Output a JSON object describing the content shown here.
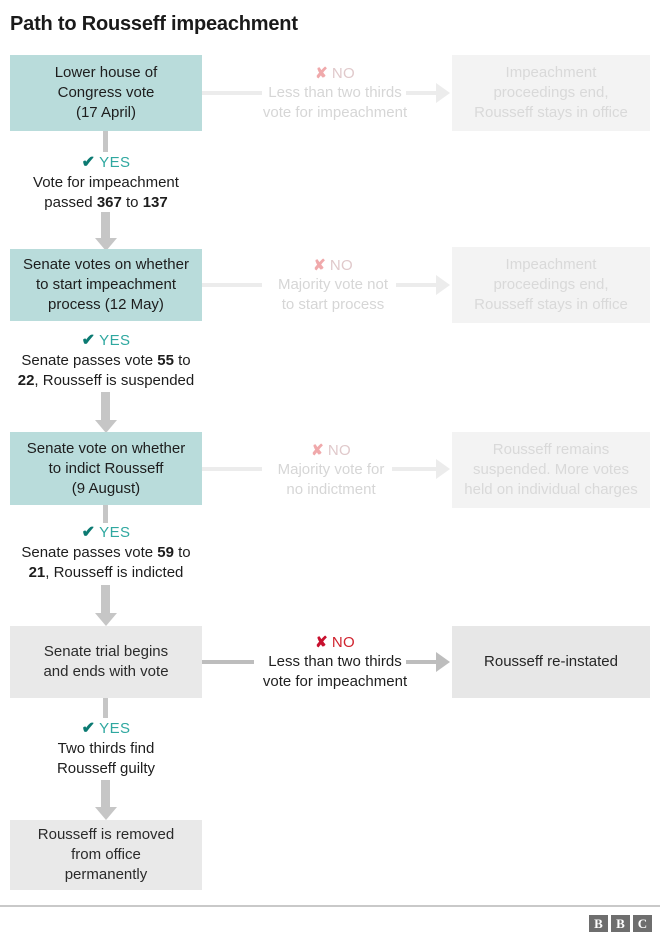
{
  "title": "Path to Rousseff impeachment",
  "icons": {
    "yes": "✔",
    "no": "✘"
  },
  "labels": {
    "yes": "YES",
    "no": "NO"
  },
  "stages": [
    {
      "decision": "Lower house of\nCongress vote\n(17 April)",
      "decision_line1": "Lower house of",
      "decision_line2": "Congress vote",
      "decision_line3": "(17 April)",
      "no_body_line1": "Less than two thirds",
      "no_body_line2": "vote for impeachment",
      "outcome_line1": "Impeachment",
      "outcome_line2": "proceedings end,",
      "outcome_line3": "Rousseff stays in office",
      "yes_line1": "Vote for impeachment",
      "yes_line2_a": "passed ",
      "yes_line2_b": "367",
      "yes_line2_c": " to ",
      "yes_line2_d": "137"
    },
    {
      "decision_line1": "Senate votes on whether",
      "decision_line2": "to start impeachment",
      "decision_line3": "process (12 May)",
      "no_body_line1": "Majority vote not",
      "no_body_line2": "to start process",
      "outcome_line1": "Impeachment",
      "outcome_line2": "proceedings end,",
      "outcome_line3": "Rousseff stays in office",
      "yes_line1_a": "Senate passes vote ",
      "yes_line1_b": "55",
      "yes_line1_c": " to",
      "yes_line2_a": "22",
      "yes_line2_b": ", Rousseff is suspended"
    },
    {
      "decision_line1": "Senate vote on whether",
      "decision_line2": "to indict Rousseff",
      "decision_line3": "(9 August)",
      "no_body_line1": "Majority vote for",
      "no_body_line2": "no indictment",
      "outcome_line1": "Rousseff remains",
      "outcome_line2": "suspended. More votes",
      "outcome_line3": "held on individual charges",
      "yes_line1_a": "Senate passes vote ",
      "yes_line1_b": "59",
      "yes_line1_c": " to",
      "yes_line2_a": "21",
      "yes_line2_b": ", Rousseff is indicted"
    },
    {
      "decision_line1": "Senate trial begins",
      "decision_line2": "and ends with vote",
      "no_body_line1": "Less than two thirds",
      "no_body_line2": "vote for impeachment",
      "outcome_line1": "Rousseff re-instated",
      "yes_line1": "Two thirds find",
      "yes_line2": "Rousseff guilty"
    }
  ],
  "final": {
    "line1": "Rousseff is removed",
    "line2": "from office",
    "line3": "permanently"
  },
  "brand": {
    "b1": "B",
    "b2": "B",
    "b3": "C"
  },
  "colors": {
    "teal_box": "#b9dcdb",
    "grey_box": "#e9e9e9",
    "faded_box": "#f3f3f3",
    "yes_check": "#0b7a72",
    "yes_word": "#2fa8a0",
    "no_red": "#c8102e",
    "connector": "#c6c6c6"
  }
}
